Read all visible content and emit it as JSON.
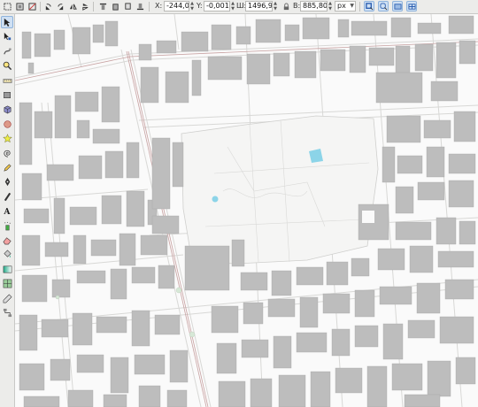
{
  "toolbar": {
    "x_label": "X:",
    "x_value": "-244,09",
    "y_label": "Y:",
    "y_value": "-0,001",
    "w_label": "Ш:",
    "w_value": "1496,93",
    "h_label": "В:",
    "h_value": "885,800",
    "unit": "px"
  },
  "tools": [
    {
      "name": "selector",
      "icon": "arrow-pointer-icon",
      "active": true
    },
    {
      "name": "node",
      "icon": "node-edit-icon",
      "active": false
    },
    {
      "name": "tweak",
      "icon": "tweak-icon",
      "active": false
    },
    {
      "name": "zoom",
      "icon": "zoom-icon",
      "active": false
    },
    {
      "name": "measure",
      "icon": "ruler-icon",
      "active": false
    },
    {
      "name": "rectangle",
      "icon": "rectangle-icon",
      "active": false
    },
    {
      "name": "3d-box",
      "icon": "cube-icon",
      "active": false
    },
    {
      "name": "ellipse",
      "icon": "ellipse-icon",
      "active": false
    },
    {
      "name": "star",
      "icon": "star-icon",
      "active": false
    },
    {
      "name": "spiral",
      "icon": "spiral-icon",
      "active": false
    },
    {
      "name": "pencil",
      "icon": "pencil-icon",
      "active": false
    },
    {
      "name": "pen",
      "icon": "pen-icon",
      "active": false
    },
    {
      "name": "calligraphy",
      "icon": "calligraphy-icon",
      "active": false
    },
    {
      "name": "text",
      "icon": "text-icon",
      "active": false
    },
    {
      "name": "spray",
      "icon": "spray-icon",
      "active": false
    },
    {
      "name": "eraser",
      "icon": "eraser-icon",
      "active": false
    },
    {
      "name": "bucket",
      "icon": "paint-bucket-icon",
      "active": false
    },
    {
      "name": "gradient",
      "icon": "gradient-icon",
      "active": false
    },
    {
      "name": "mesh",
      "icon": "mesh-icon",
      "active": false
    },
    {
      "name": "dropper",
      "icon": "dropper-icon",
      "active": false
    },
    {
      "name": "connector",
      "icon": "connector-icon",
      "active": false
    }
  ],
  "colors": {
    "building": "#bdbdbd",
    "building_edge": "#a9a9a9",
    "road_casing": "#d4d4d2",
    "tram": "#c8a2a2",
    "water": "#8cd4e8",
    "selection": "#e9a0a0"
  }
}
